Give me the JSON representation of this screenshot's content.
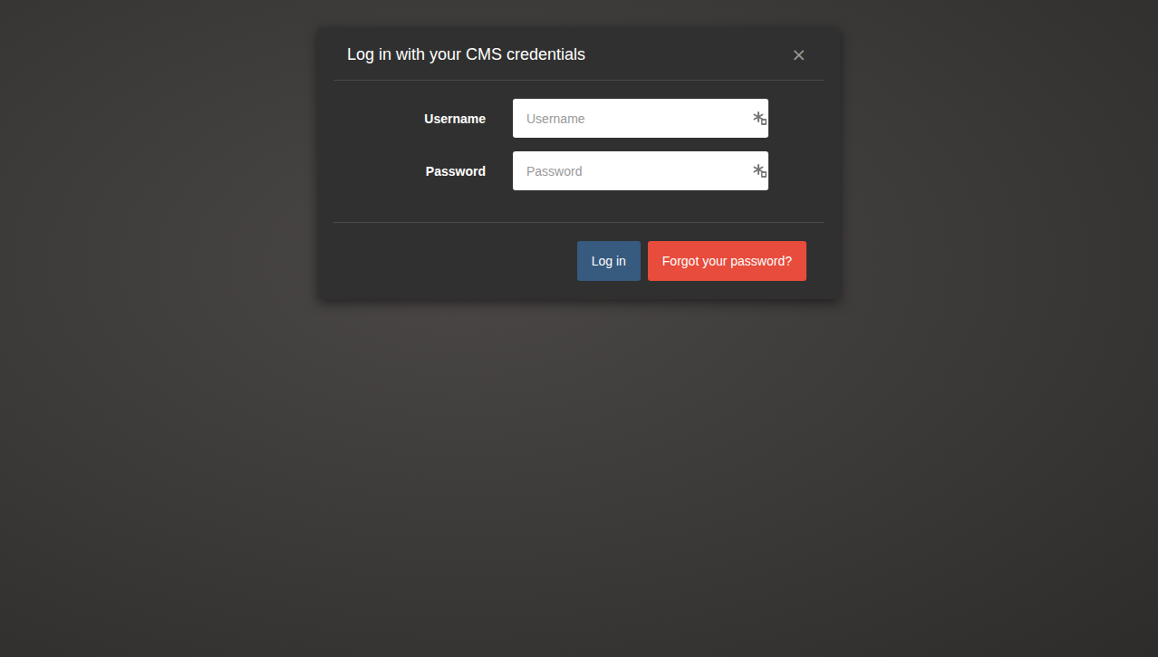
{
  "dialog": {
    "title": "Log in with your CMS credentials",
    "close": "×"
  },
  "fields": [
    {
      "label": "Username",
      "placeholder": "Username",
      "kind": "text"
    },
    {
      "label": "Password",
      "placeholder": "Password",
      "kind": "password"
    }
  ],
  "buttons": [
    {
      "label": "Log in",
      "kind": "primary"
    },
    {
      "label": "Forgot your password?",
      "kind": "danger"
    }
  ]
}
